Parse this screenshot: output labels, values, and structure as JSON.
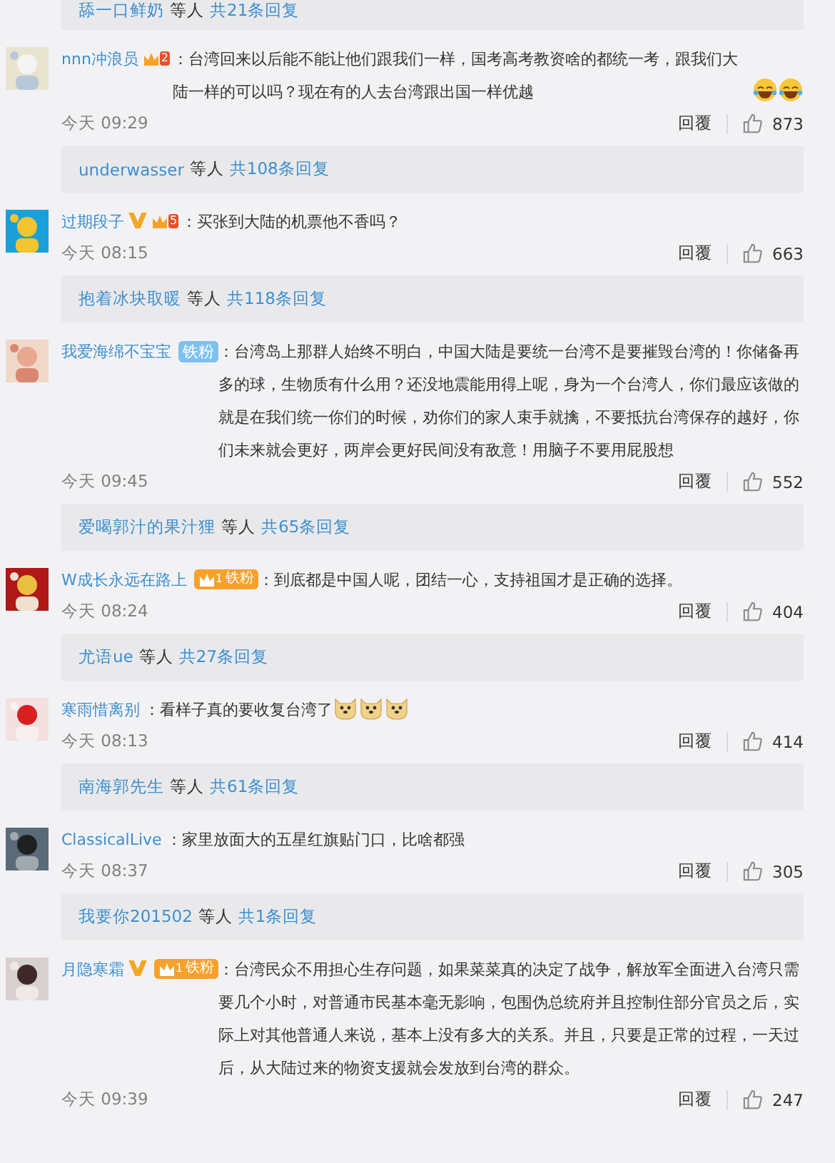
{
  "top_reply_summary": {
    "user": "舔一口鲜奶",
    "others": "等人",
    "count": "共21条回复"
  },
  "comments": [
    {
      "user": "nnn冲浪员",
      "badges": [
        {
          "kind": "crown",
          "level": "2"
        }
      ],
      "text": "：台湾回来以后能不能让他们跟我们一样，国考高考教资啥的都统一考，跟我们大陆一样的可以吗？现在有的人去台湾跟出国一样优越",
      "emojis": [
        {
          "kind": "laugh"
        },
        {
          "kind": "laugh"
        }
      ],
      "time": "今天 09:29",
      "reply": "回覆",
      "likes": "873",
      "replies": {
        "user": "underwasser",
        "others": "等人",
        "count": "共108条回复"
      }
    },
    {
      "user": "过期段子",
      "badges": [
        {
          "kind": "verified"
        },
        {
          "kind": "crown",
          "level": "5"
        }
      ],
      "text": "：买张到大陆的机票他不香吗？",
      "time": "今天 08:15",
      "reply": "回覆",
      "likes": "663",
      "replies": {
        "user": "抱着冰块取暖",
        "others": "等人",
        "count": "共118条回复"
      }
    },
    {
      "user": "我爱海绵不宝宝",
      "badges": [
        {
          "kind": "fan",
          "label": "铁粉"
        }
      ],
      "text": "：台湾岛上那群人始终不明白，中国大陆是要统一台湾不是要摧毁台湾的！你储备再多的球，生物质有什么用？还没地震能用得上呢，身为一个台湾人，你们最应该做的就是在我们统一你们的时候，劝你们的家人束手就擒，不要抵抗台湾保存的越好，你们未来就会更好，两岸会更好民间没有敌意！用脑子不要用屁股想",
      "time": "今天 09:45",
      "reply": "回覆",
      "likes": "552",
      "replies": {
        "user": "爱喝郭汁的果汁狸",
        "others": "等人",
        "count": "共65条回复"
      }
    },
    {
      "user": "W成长永远在路上",
      "badges": [
        {
          "kind": "crown_fan",
          "level": "1",
          "label": "铁粉"
        }
      ],
      "text": "：到底都是中国人呢，团结一心，支持祖国才是正确的选择。",
      "time": "今天 08:24",
      "reply": "回覆",
      "likes": "404",
      "replies": {
        "user": "尤语ue",
        "others": "等人",
        "count": "共27条回复"
      }
    },
    {
      "user": "寒雨惜离别",
      "text": "：看样子真的要收复台湾了",
      "emojis": [
        {
          "kind": "doge"
        },
        {
          "kind": "doge"
        },
        {
          "kind": "doge"
        }
      ],
      "time": "今天 08:13",
      "reply": "回覆",
      "likes": "414",
      "replies": {
        "user": "南海郭先生",
        "others": "等人",
        "count": "共61条回复"
      }
    },
    {
      "user": "ClassicalLive",
      "text": "：家里放面大的五星红旗贴门口，比啥都强",
      "time": "今天 08:37",
      "reply": "回覆",
      "likes": "305",
      "replies": {
        "user": "我要你201502",
        "others": "等人",
        "count": "共1条回复"
      }
    },
    {
      "user": "月隐寒霜",
      "badges": [
        {
          "kind": "verified"
        },
        {
          "kind": "crown_fan",
          "level": "1",
          "label": "铁粉"
        }
      ],
      "text": "：台湾民众不用担心生存问题，如果菜菜真的决定了战争，解放军全面进入台湾只需要几个小时，对普通市民基本毫无影响，包围伪总统府并且控制住部分官员之后，实际上对其他普通人来说，基本上没有多大的关系。并且，只要是正常的过程，一天过后，从大陆过来的物资支援就会发放到台湾的群众。",
      "time": "今天 09:39",
      "reply": "回覆",
      "likes": "247"
    }
  ]
}
